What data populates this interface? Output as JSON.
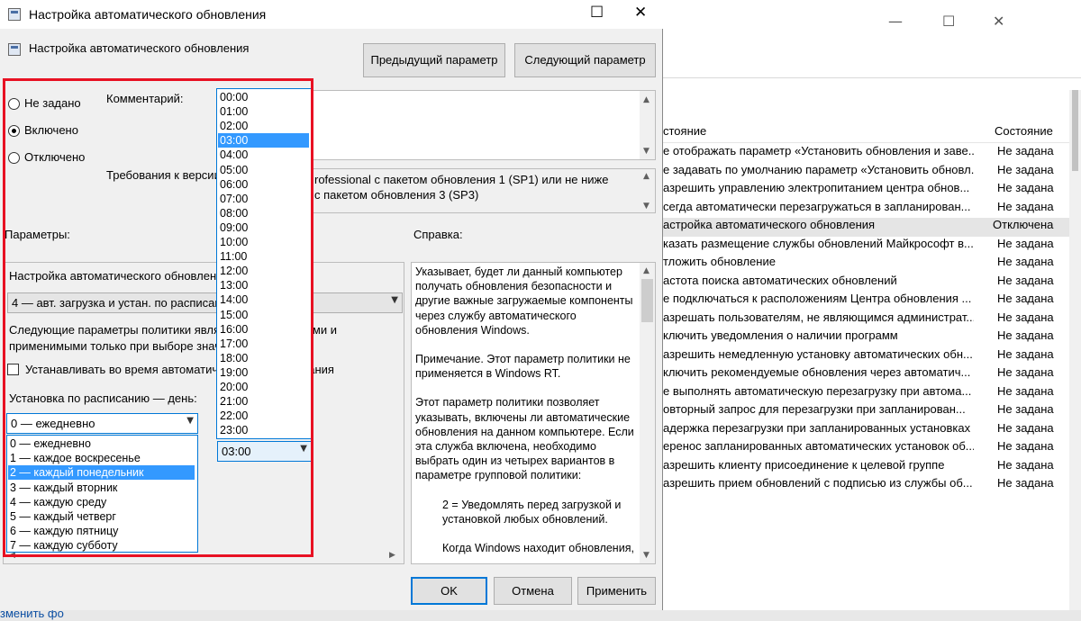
{
  "background_window": {
    "columns": {
      "name": "стояние",
      "state": "Состояние"
    },
    "rows": [
      {
        "name": "е отображать параметр «Установить обновления и заве...",
        "state": "Не задана"
      },
      {
        "name": "е задавать по умолчанию параметр «Установить обновл...",
        "state": "Не задана"
      },
      {
        "name": "азрешить управлению электропитанием центра обнов...",
        "state": "Не задана"
      },
      {
        "name": "сегда автоматически перезагружаться в запланирован...",
        "state": "Не задана"
      },
      {
        "name": "астройка автоматического обновления",
        "state": "Отключена"
      },
      {
        "name": "казать размещение службы обновлений Майкрософт в...",
        "state": "Не задана"
      },
      {
        "name": "тложить обновление",
        "state": "Не задана"
      },
      {
        "name": "астота поиска автоматических обновлений",
        "state": "Не задана"
      },
      {
        "name": "е подключаться к расположениям Центра обновления ...",
        "state": "Не задана"
      },
      {
        "name": "азрешать пользователям, не являющимся администрат...",
        "state": "Не задана"
      },
      {
        "name": "ключить уведомления о наличии программ",
        "state": "Не задана"
      },
      {
        "name": "азрешить немедленную установку автоматических обн...",
        "state": "Не задана"
      },
      {
        "name": "ключить рекомендуемые обновления через автоматич...",
        "state": "Не задана"
      },
      {
        "name": "е выполнять автоматическую перезагрузку при автома...",
        "state": "Не задана"
      },
      {
        "name": "овторный запрос для перезагрузки при запланирован...",
        "state": "Не задана"
      },
      {
        "name": "адержка перезагрузки при запланированных установках",
        "state": "Не задана"
      },
      {
        "name": "еренос запланированных автоматических установок об...",
        "state": "Не задана"
      },
      {
        "name": "азрешить клиенту присоединение к целевой группе",
        "state": "Не задана"
      },
      {
        "name": "азрешить прием обновлений с подписью из службы об...",
        "state": "Не задана"
      }
    ],
    "status_text": "зменить фо"
  },
  "dialog": {
    "window_title": "Настройка автоматического обновления",
    "header_title": "Настройка автоматического обновления",
    "prev_button": "Предыдущий параметр",
    "next_button": "Следующий параметр",
    "radio": {
      "not_set": "Не задано",
      "enabled": "Включено",
      "disabled": "Отключено",
      "selected": "enabled"
    },
    "comment_label": "Комментарий:",
    "requirements_label": "Требования к версии:",
    "requirements_text_1": "rofessional с пакетом обновления 1 (SP1) или не ниже",
    "requirements_text_2": "с пакетом обновления 3 (SP3)",
    "params_label": "Параметры:",
    "help_label": "Справка:",
    "options": {
      "config_label": "Настройка автоматического обновления:",
      "config_value": "4 — авт. загрузка и устан. по расписанию",
      "note_line1": "Следующие параметры политики являются применимыми и",
      "note_line2": "применимыми только при выборе значения 4.",
      "install_checkbox": "Устанавливать во время автоматического обслуживания",
      "schedule_day_label": "Установка по расписанию — день:",
      "day_value": "0 — ежедневно",
      "day_options": [
        "0 — ежедневно",
        "1 — каждое воскресенье",
        "2 — каждый понедельник",
        "3 — каждый вторник",
        "4 — каждую среду",
        "5 — каждый четверг",
        "6 — каждую пятницу",
        "7 — каждую субботу"
      ],
      "day_highlighted": 2,
      "time_value": "03:00",
      "time_options": [
        "00:00",
        "01:00",
        "02:00",
        "03:00",
        "04:00",
        "05:00",
        "06:00",
        "07:00",
        "08:00",
        "09:00",
        "10:00",
        "11:00",
        "12:00",
        "13:00",
        "14:00",
        "15:00",
        "16:00",
        "17:00",
        "18:00",
        "19:00",
        "20:00",
        "21:00",
        "22:00",
        "23:00"
      ],
      "time_highlighted": 3
    },
    "help_paragraphs": [
      "Указывает, будет ли данный компьютер получать обновления безопасности и другие важные загружаемые компоненты через службу автоматического обновления Windows.",
      "Примечание. Этот параметр политики не применяется в Windows RT.",
      "Этот параметр политики позволяет указывать, включены ли автоматические обновления на данном компьютере. Если эта служба включена, необходимо выбрать один из четырех вариантов в параметре групповой политики:",
      "2 = Уведомлять перед загрузкой и установкой любых обновлений.",
      "Когда Windows находит обновления,"
    ],
    "ok_button": "OK",
    "cancel_button": "Отмена",
    "apply_button": "Применить"
  },
  "colors": {
    "highlight": "#3399ff",
    "annotation": "#e81123",
    "focus": "#0078d7"
  }
}
